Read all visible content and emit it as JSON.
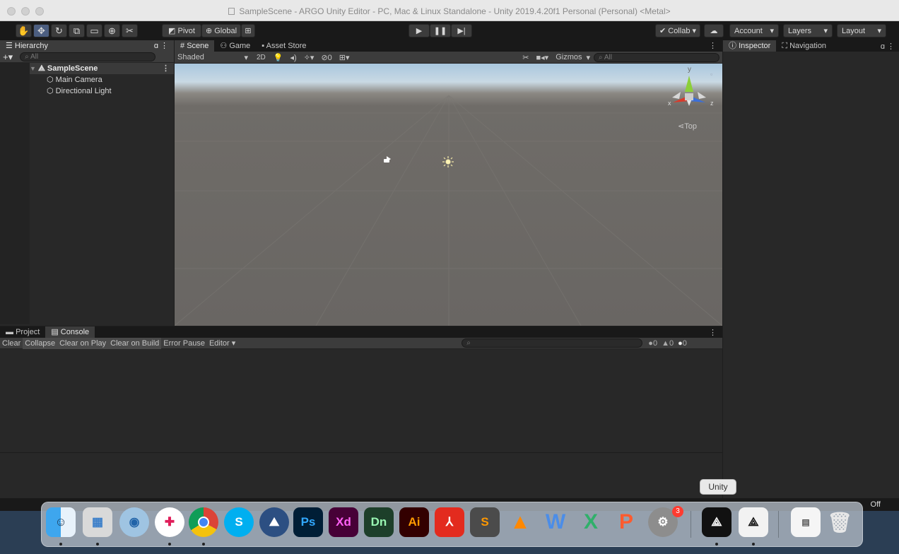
{
  "window": {
    "title": "SampleScene - ARGO Unity Editor - PC, Mac & Linux Standalone - Unity 2019.4.20f1 Personal (Personal) <Metal>"
  },
  "toolbar": {
    "tools": [
      "hand-tool",
      "move-tool",
      "rotate-tool",
      "scale-tool",
      "rect-tool",
      "transform-tool",
      "custom-tool"
    ],
    "pivot_label": "Pivot",
    "global_label": "Global",
    "collab_label": "Collab ▾",
    "account_label": "Account",
    "layers_label": "Layers",
    "layout_label": "Layout"
  },
  "hierarchy": {
    "tab_label": "Hierarchy",
    "search_placeholder": "All",
    "scene_name": "SampleScene",
    "items": [
      "Main Camera",
      "Directional Light"
    ]
  },
  "scene": {
    "tabs": [
      "Scene",
      "Game",
      "Asset Store"
    ],
    "shading_mode": "Shaded",
    "mode_2d": "2D",
    "hidden_count": "0",
    "gizmos_label": "Gizmos",
    "search_placeholder": "All",
    "gizmo_x": "x",
    "gizmo_y": "y",
    "gizmo_z": "z",
    "view_label": "Top"
  },
  "inspector": {
    "tabs": [
      "Inspector",
      "Navigation"
    ]
  },
  "console": {
    "tabs": [
      "Project",
      "Console"
    ],
    "buttons": [
      "Clear",
      "Collapse",
      "Clear on Play",
      "Clear on Build",
      "Error Pause",
      "Editor ▾"
    ],
    "active_buttons": [
      "Collapse",
      "Clear on Play",
      "Clear on Build"
    ],
    "log_count": "0",
    "warning_count": "0",
    "error_count": "0"
  },
  "status": {
    "right_text": "Off"
  },
  "dock": {
    "tooltip": "Unity",
    "badge_count": "3",
    "apps": [
      {
        "name": "finder-icon",
        "label": ""
      },
      {
        "name": "preview-icon",
        "label": ""
      },
      {
        "name": "quicktime-icon",
        "label": ""
      },
      {
        "name": "slack-icon",
        "label": ""
      },
      {
        "name": "chrome-icon",
        "label": ""
      },
      {
        "name": "skype-icon",
        "label": "S"
      },
      {
        "name": "app-icon",
        "label": ""
      },
      {
        "name": "photoshop-icon",
        "label": "Ps"
      },
      {
        "name": "xd-icon",
        "label": "Xd"
      },
      {
        "name": "dimension-icon",
        "label": "Dn"
      },
      {
        "name": "illustrator-icon",
        "label": "Ai"
      },
      {
        "name": "acrobat-icon",
        "label": ""
      },
      {
        "name": "sublime-icon",
        "label": ""
      },
      {
        "name": "vlc-icon",
        "label": ""
      },
      {
        "name": "word-icon",
        "label": "W"
      },
      {
        "name": "excel-icon",
        "label": "X"
      },
      {
        "name": "powerpoint-icon",
        "label": "P"
      },
      {
        "name": "system-preferences-icon",
        "label": ""
      },
      {
        "name": "unity-icon",
        "label": ""
      },
      {
        "name": "unity-hub-icon",
        "label": ""
      },
      {
        "name": "preview-document-icon",
        "label": ""
      },
      {
        "name": "trash-icon",
        "label": ""
      }
    ],
    "colors": {
      "photoshop": "#001e36",
      "xd": "#470137",
      "dimension": "#1d3f2a",
      "illustrator": "#330000"
    }
  },
  "colors": {
    "editor_bg": "#282828",
    "toolbar_bg": "#191919",
    "active_tool": "#4c5e80",
    "sky": "#a9c7de",
    "ground": "#696663"
  }
}
